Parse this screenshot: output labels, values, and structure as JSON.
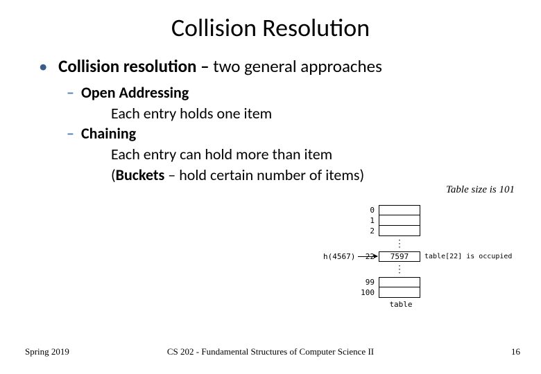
{
  "title": "Collision Resolution",
  "main_bullet": {
    "bold": "Collision resolution –",
    "rest": " two general approaches"
  },
  "items": {
    "open_addr": {
      "label": "Open Addressing",
      "desc": "Each entry holds one item"
    },
    "chaining": {
      "label": "Chaining",
      "desc_plain1": "Each entry can hold more than item",
      "buckets_bold": "Buckets",
      "desc_plain2": " – hold certain number of items)"
    }
  },
  "caption": "Table size is 101",
  "footer": {
    "left": "Spring 2019",
    "center": "CS 202 - Fundamental Structures of Computer Science II",
    "right": "16"
  },
  "diagram": {
    "harrow_label": "h(4567)",
    "value22": "7597",
    "note22": "table[22] is occupied",
    "idx": {
      "0": "0",
      "1": "1",
      "2": "2",
      "22": "22",
      "99": "99",
      "100": "100"
    },
    "table_label": "table"
  }
}
